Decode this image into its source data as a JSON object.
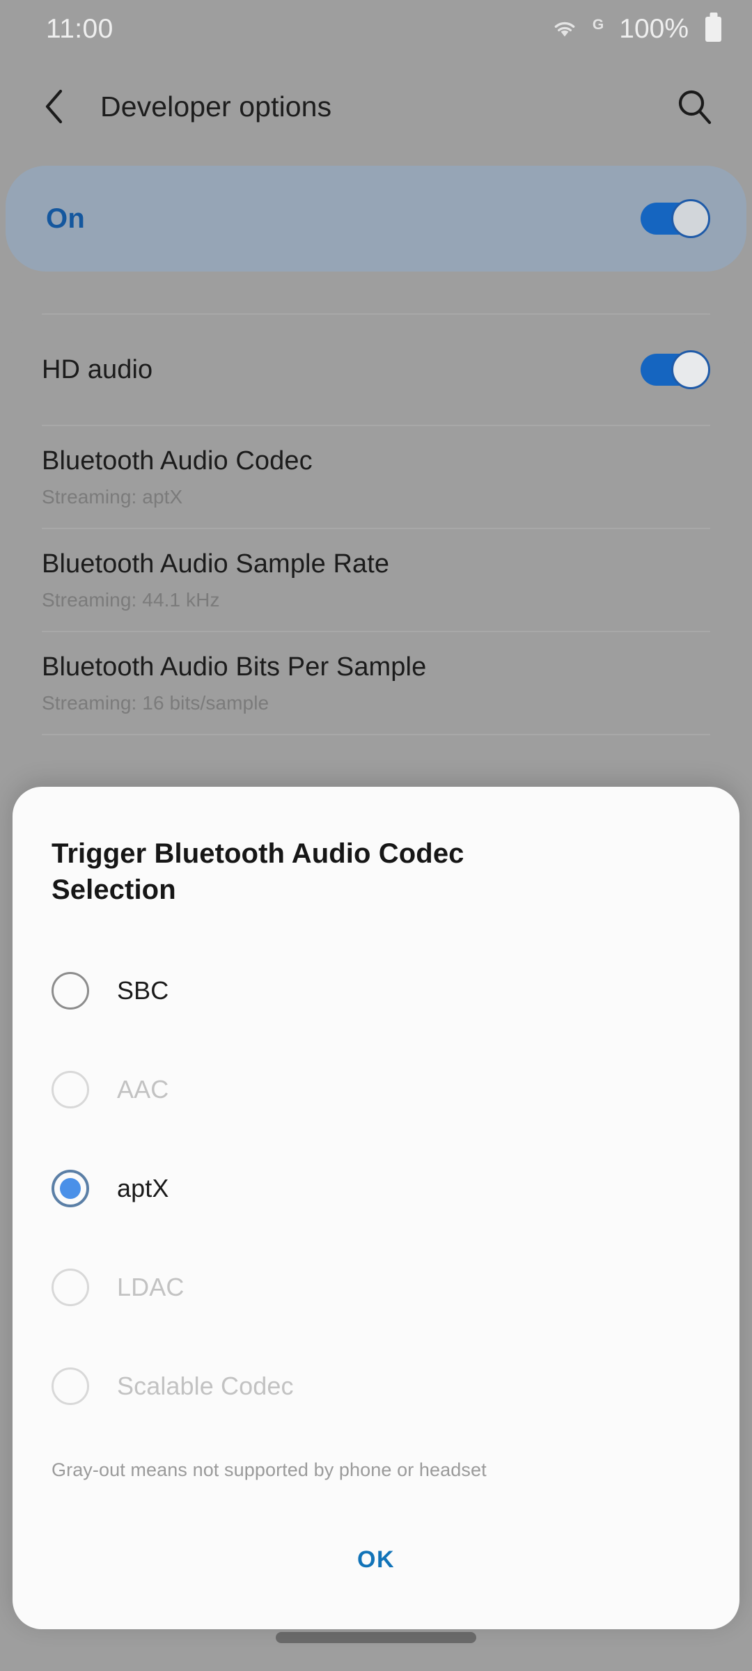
{
  "status_bar": {
    "clock": "11:00",
    "wifi_icon": "wifi-icon",
    "network_label": "G",
    "battery_percent": "100%",
    "battery_icon": "battery-full-icon"
  },
  "app_bar": {
    "back_icon": "chevron-left-icon",
    "title": "Developer options",
    "search_icon": "search-icon"
  },
  "master_switch": {
    "label": "On",
    "state": "on"
  },
  "settings_list": [
    {
      "title": "HD audio",
      "subtitle": "",
      "control": "toggle",
      "state": "on"
    },
    {
      "title": "Bluetooth Audio Codec",
      "subtitle": "Streaming: aptX",
      "control": "none",
      "state": ""
    },
    {
      "title": "Bluetooth Audio Sample Rate",
      "subtitle": "Streaming: 44.1 kHz",
      "control": "none",
      "state": ""
    },
    {
      "title": "Bluetooth Audio Bits Per Sample",
      "subtitle": "Streaming: 16 bits/sample",
      "control": "none",
      "state": ""
    }
  ],
  "background_peek_text": "Streaming",
  "dialog": {
    "title": "Trigger Bluetooth Audio Codec Selection",
    "options": [
      {
        "label": "SBC",
        "selected": false,
        "disabled": false
      },
      {
        "label": "AAC",
        "selected": false,
        "disabled": true
      },
      {
        "label": "aptX",
        "selected": true,
        "disabled": false
      },
      {
        "label": "LDAC",
        "selected": false,
        "disabled": true
      },
      {
        "label": "Scalable Codec",
        "selected": false,
        "disabled": true
      }
    ],
    "note": "Gray-out means not supported by phone or headset",
    "ok_label": "OK"
  },
  "nav_bar": {
    "gesture_handle": "gesture-bar"
  },
  "colors": {
    "accent_blue": "#1565c0",
    "radio_blue": "#4a90e8",
    "ok_blue": "#1173b8",
    "master_card_bg": "#96a5b6",
    "master_label": "#14579e",
    "screen_bg": "#9e9e9e",
    "dialog_bg": "#fbfbfb"
  }
}
